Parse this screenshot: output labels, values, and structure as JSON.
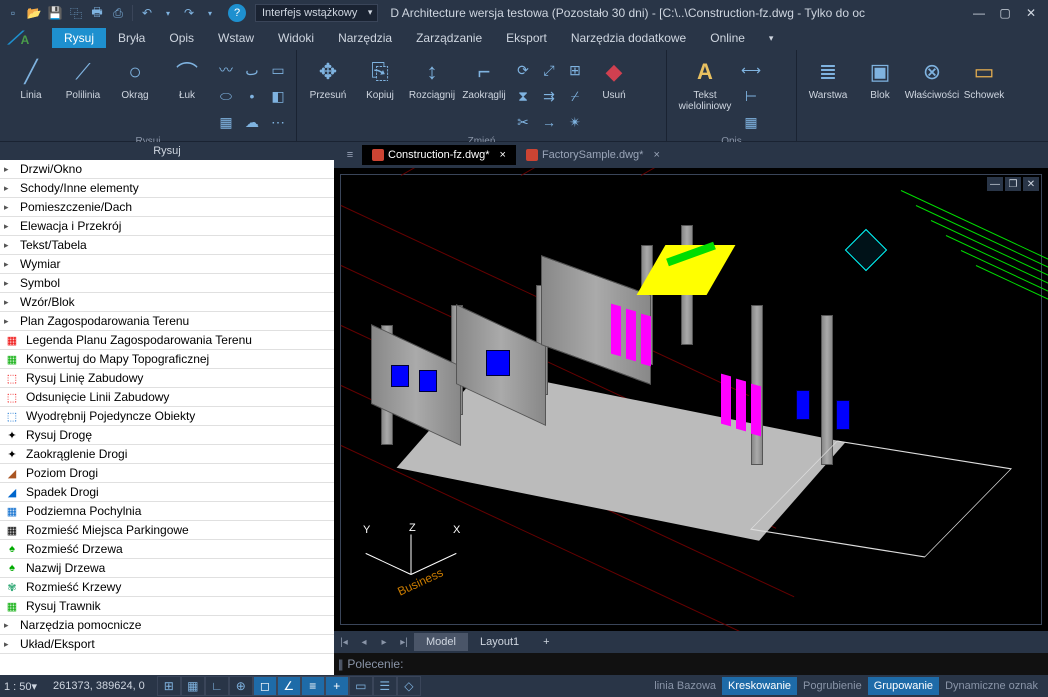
{
  "title": "D Architecture wersja testowa (Pozostało 30 dni)  -  [C:\\..\\Construction-fz.dwg - Tylko do oc",
  "style_dropdown": "Interfejs wstążkowy",
  "menu": {
    "items": [
      "Rysuj",
      "Bryła",
      "Opis",
      "Wstaw",
      "Widoki",
      "Narzędzia",
      "Zarządzanie",
      "Eksport",
      "Narzędzia dodatkowe",
      "Online"
    ],
    "active": 0
  },
  "ribbon": {
    "groups": [
      {
        "title": "Rysuj",
        "big": [
          {
            "label": "Linia",
            "ico": "╱"
          },
          {
            "label": "Polilinia",
            "ico": "⟋"
          },
          {
            "label": "Okrąg",
            "ico": "○"
          },
          {
            "label": "Łuk",
            "ico": "⌒"
          }
        ]
      },
      {
        "title": "Zmień",
        "big": [
          {
            "label": "Przesuń",
            "ico": "✥"
          },
          {
            "label": "Kopiuj",
            "ico": "⎘"
          },
          {
            "label": "Rozciągnij",
            "ico": "↕"
          },
          {
            "label": "Zaokrąglij",
            "ico": "⌐"
          }
        ],
        "erase": {
          "label": "Usuń",
          "ico": "◆"
        }
      },
      {
        "title": "Opis",
        "big": [
          {
            "label": "Tekst\nwieloliniowy",
            "ico": "A"
          }
        ]
      },
      {
        "title": "",
        "big": [
          {
            "label": "Warstwa",
            "ico": "≡"
          },
          {
            "label": "Blok",
            "ico": "▣"
          },
          {
            "label": "Właściwości",
            "ico": "⊗"
          },
          {
            "label": "Schowek",
            "ico": "▭"
          }
        ]
      }
    ]
  },
  "sidepanel": {
    "header": "Rysuj",
    "items": [
      {
        "type": "arrow",
        "label": "Drzwi/Okno"
      },
      {
        "type": "arrow",
        "label": "Schody/Inne elementy"
      },
      {
        "type": "arrow",
        "label": "Pomieszczenie/Dach"
      },
      {
        "type": "arrow",
        "label": "Elewacja i Przekrój"
      },
      {
        "type": "arrow",
        "label": "Tekst/Tabela"
      },
      {
        "type": "arrow",
        "label": "Wymiar"
      },
      {
        "type": "arrow",
        "label": "Symbol"
      },
      {
        "type": "arrow",
        "label": "Wzór/Blok"
      },
      {
        "type": "arrow",
        "label": "Plan Zagospodarowania Terenu"
      },
      {
        "type": "ico",
        "icocolor": "#e00",
        "ico": "▦",
        "label": "Legenda Planu Zagospodarowania Terenu"
      },
      {
        "type": "ico",
        "icocolor": "#0a0",
        "ico": "▦",
        "label": "Konwertuj do Mapy Topograficznej"
      },
      {
        "type": "ico",
        "icocolor": "#e00",
        "ico": "⬚",
        "label": "Rysuj Linię Zabudowy"
      },
      {
        "type": "ico",
        "icocolor": "#e00",
        "ico": "⬚",
        "label": "Odsunięcie Linii Zabudowy"
      },
      {
        "type": "ico",
        "icocolor": "#06c",
        "ico": "⬚",
        "label": "Wyodrębnij Pojedyncze Obiekty"
      },
      {
        "type": "ico",
        "icocolor": "#000",
        "ico": "✦",
        "label": "Rysuj Drogę"
      },
      {
        "type": "ico",
        "icocolor": "#000",
        "ico": "✦",
        "label": "Zaokrąglenie Drogi"
      },
      {
        "type": "ico",
        "icocolor": "#a52",
        "ico": "◢",
        "label": "Poziom Drogi"
      },
      {
        "type": "ico",
        "icocolor": "#06c",
        "ico": "◢",
        "label": "Spadek Drogi"
      },
      {
        "type": "ico",
        "icocolor": "#06c",
        "ico": "▦",
        "label": "Podziemna Pochylnia"
      },
      {
        "type": "ico",
        "icocolor": "#000",
        "ico": "▦",
        "label": "Rozmieść Miejsca Parkingowe"
      },
      {
        "type": "ico",
        "icocolor": "#0a0",
        "ico": "♠",
        "label": "Rozmieść Drzewa"
      },
      {
        "type": "ico",
        "icocolor": "#0a0",
        "ico": "♠",
        "label": "Nazwij Drzewa"
      },
      {
        "type": "ico",
        "icocolor": "#3a7",
        "ico": "✾",
        "label": "Rozmieść Krzewy"
      },
      {
        "type": "ico",
        "icocolor": "#0a0",
        "ico": "▦",
        "label": "Rysuj Trawnik"
      },
      {
        "type": "arrow",
        "label": "Narzędzia pomocnicze"
      },
      {
        "type": "arrow",
        "label": "Układ/Eksport"
      }
    ]
  },
  "doctabs": [
    {
      "label": "Construction-fz.dwg*",
      "active": true
    },
    {
      "label": "FactorySample.dwg*",
      "active": false
    }
  ],
  "layout_tabs": {
    "tabs": [
      "Model",
      "Layout1"
    ],
    "active": 0,
    "plus": "+"
  },
  "commandline": {
    "prompt": "Polecenie:",
    "value": ""
  },
  "statusbar": {
    "scale": "1 : 50▾",
    "coords": "261373, 389624, 0",
    "toggles": [
      "linia Bazowa",
      "Kreskowanie",
      "Pogrubienie",
      "Grupowanie",
      "Dynamiczne oznak"
    ],
    "toggles_on": [
      1,
      3
    ]
  },
  "axes": {
    "x": "X",
    "y": "Y",
    "z": "Z",
    "brand": "Business"
  }
}
